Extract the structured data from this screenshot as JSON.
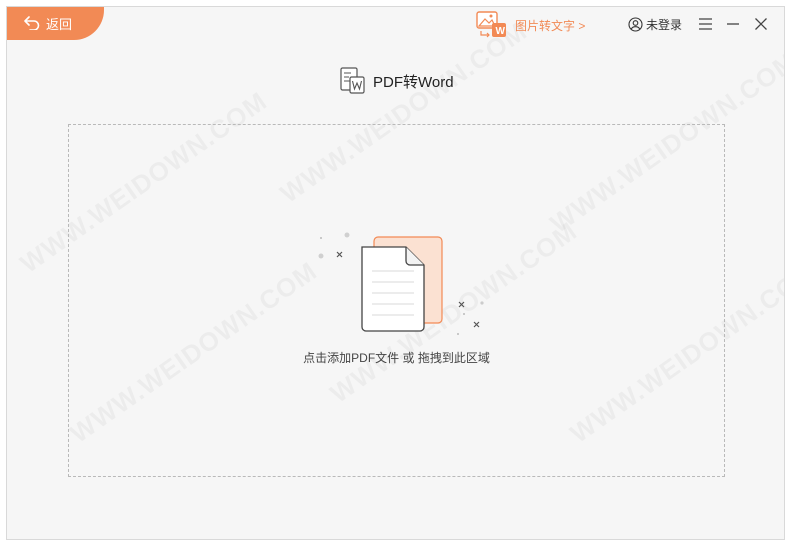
{
  "header": {
    "back_label": "返回",
    "img2txt_label": "图片转文字 >",
    "login_label": "未登录"
  },
  "main": {
    "title": "PDF转Word",
    "drop_hint": "点击添加PDF文件 或 拖拽到此区域"
  },
  "watermark": "WWW.WEIDOWN.COM",
  "colors": {
    "accent": "#f28a55",
    "background": "#f6f6f6",
    "doc_back": "#fbe1d2"
  },
  "icons": {
    "back": "back-arrow-icon",
    "img2txt": "image-to-text-icon",
    "login": "user-circle-icon",
    "menu": "hamburger-menu-icon",
    "minimize": "minimize-icon",
    "close": "close-icon",
    "title": "pdf-to-word-icon"
  }
}
